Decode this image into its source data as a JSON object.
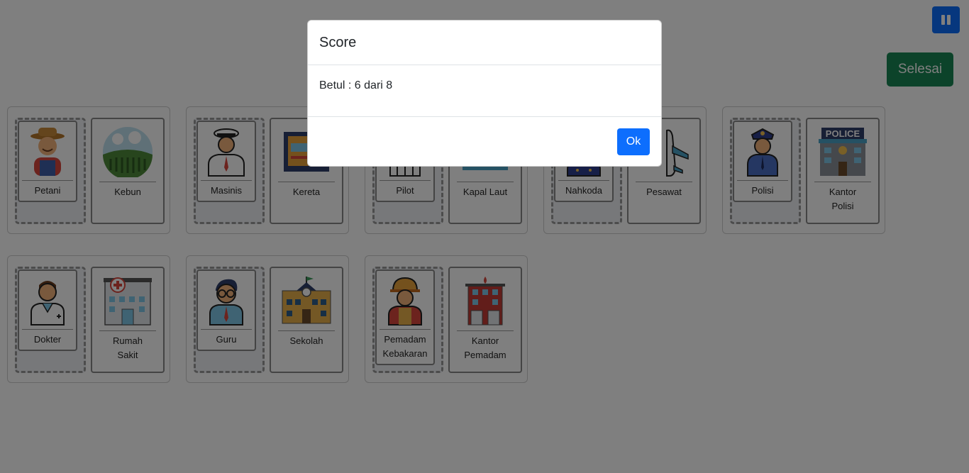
{
  "controls": {
    "selesai_label": "Selesai",
    "pause_icon": "pause-icon"
  },
  "groups_row1": [
    {
      "worker": "Petani",
      "place": "Kebun"
    },
    {
      "worker": "Masinis",
      "place": "Kereta"
    },
    {
      "worker": "Pilot",
      "place": "Kapal Laut"
    },
    {
      "worker": "Nahkoda",
      "place": "Pesawat"
    },
    {
      "worker": "Polisi",
      "place": "Kantor\nPolisi"
    }
  ],
  "groups_row2": [
    {
      "worker": "Dokter",
      "place": "Rumah\nSakit"
    },
    {
      "worker": "Guru",
      "place": "Sekolah"
    },
    {
      "worker": "Pemadam\nKebakaran",
      "place": "Kantor\nPemadam"
    }
  ],
  "modal": {
    "title": "Score",
    "body": "Betul : 6 dari 8",
    "ok_label": "Ok"
  }
}
